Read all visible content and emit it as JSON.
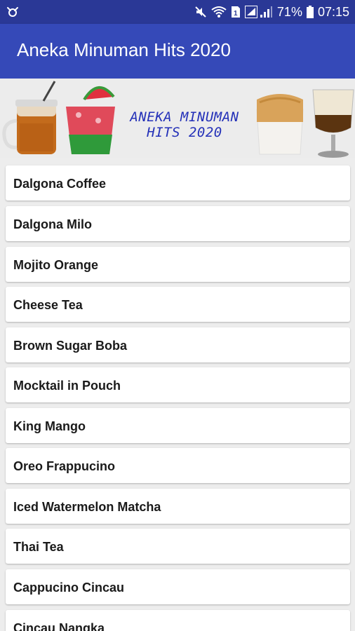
{
  "status_bar": {
    "battery_percent": "71%",
    "time": "07:15",
    "icons": [
      "notification-icon",
      "mute-icon",
      "wifi-icon",
      "sim-icon",
      "signal-icon",
      "battery-icon"
    ]
  },
  "app_bar": {
    "title": "Aneka Minuman Hits 2020"
  },
  "banner": {
    "line1": "ANEKA MINUMAN",
    "line2": "HITS 2020"
  },
  "drinks": [
    {
      "label": "Dalgona Coffee"
    },
    {
      "label": "Dalgona Milo"
    },
    {
      "label": "Mojito Orange"
    },
    {
      "label": "Cheese Tea"
    },
    {
      "label": "Brown Sugar Boba"
    },
    {
      "label": "Mocktail in Pouch"
    },
    {
      "label": "King Mango"
    },
    {
      "label": "Oreo Frappucino"
    },
    {
      "label": "Iced Watermelon Matcha"
    },
    {
      "label": "Thai Tea"
    },
    {
      "label": "Cappucino Cincau"
    },
    {
      "label": "Cincau Nangka"
    }
  ],
  "colors": {
    "status_bar": "#2a3896",
    "app_bar": "#3549b8",
    "banner_text": "#2330b8",
    "background": "#ededed"
  }
}
